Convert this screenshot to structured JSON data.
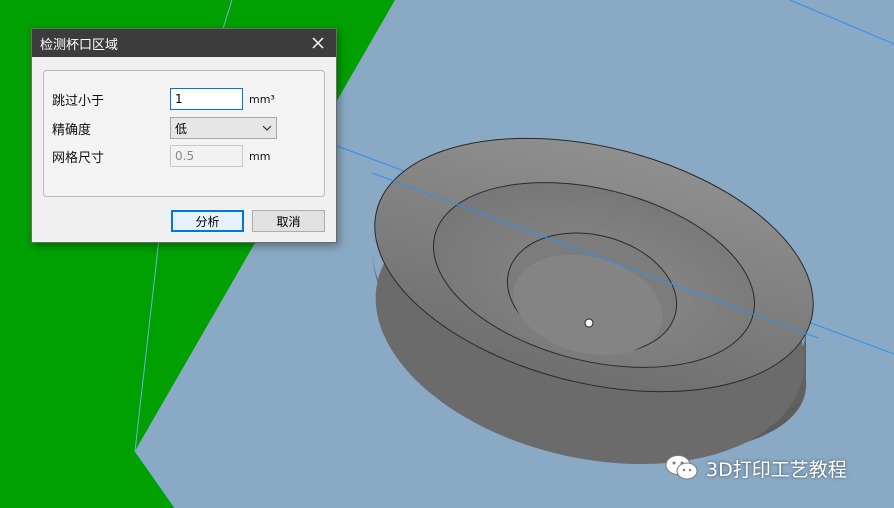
{
  "dialog": {
    "title": "检测杯口区域",
    "rows": [
      {
        "label": "跳过小于",
        "value": "1",
        "unit": "mm³"
      },
      {
        "label": "精确度",
        "selected": "低"
      },
      {
        "label": "网格尺寸",
        "value": "0.5",
        "unit": "mm"
      }
    ],
    "buttons": {
      "analyze": "分析",
      "cancel": "取消"
    }
  },
  "watermark": {
    "text": "3D打印工艺教程"
  },
  "colors": {
    "background_green": "#00a000",
    "build_plane": "#8aa9c4",
    "model_gray": "#7a7a7a",
    "axis_line": "#2f8ff0",
    "accent": "#0078d7"
  },
  "icons": [
    "close-icon",
    "chevron-down-icon",
    "wechat-icon"
  ]
}
